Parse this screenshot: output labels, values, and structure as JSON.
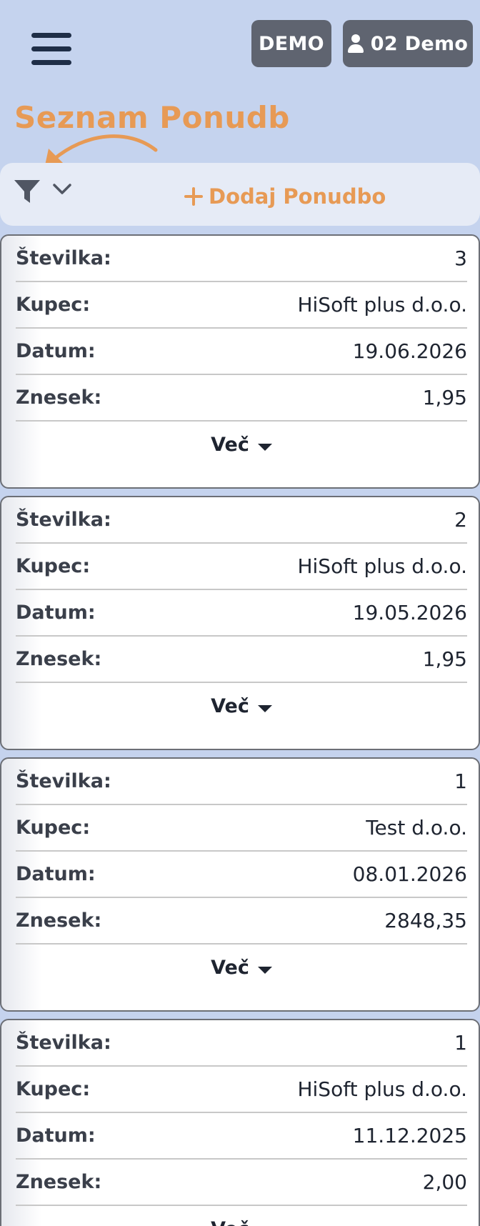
{
  "header": {
    "menu_icon": "hamburger-menu-icon",
    "demo_label": "DEMO",
    "user_label": "02 Demo",
    "user_icon": "user-icon"
  },
  "page": {
    "title": "Seznam Ponudb"
  },
  "toolbar": {
    "filter_icon": "filter-icon",
    "chevron_icon": "chevron-down-icon",
    "add_label": "Dodaj Ponudbo",
    "accent_color": "#e79a55"
  },
  "labels": {
    "number": "Številka:",
    "customer": "Kupec:",
    "date": "Datum:",
    "amount": "Znesek:",
    "more": "Več"
  },
  "offers": [
    {
      "number": "3",
      "customer": "HiSoft plus d.o.o.",
      "date": "19.06.2026",
      "amount": "1,95"
    },
    {
      "number": "2",
      "customer": "HiSoft plus d.o.o.",
      "date": "19.05.2026",
      "amount": "1,95"
    },
    {
      "number": "1",
      "customer": "Test d.o.o.",
      "date": "08.01.2026",
      "amount": "2848,35"
    },
    {
      "number": "1",
      "customer": "HiSoft plus d.o.o.",
      "date": "11.12.2025",
      "amount": "2,00"
    }
  ]
}
